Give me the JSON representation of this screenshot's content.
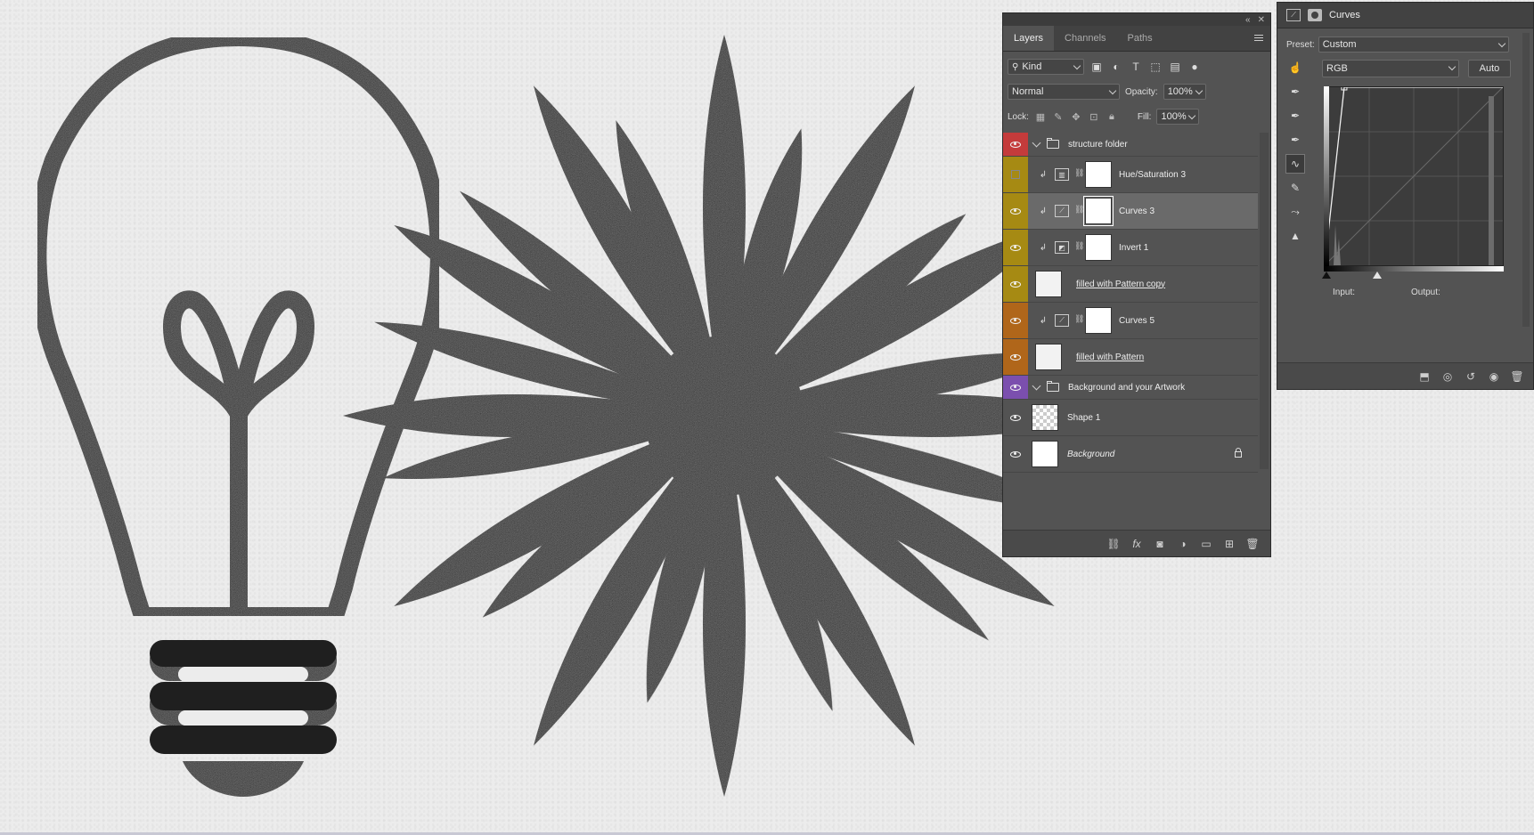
{
  "layers_panel": {
    "tabs": [
      "Layers",
      "Channels",
      "Paths"
    ],
    "filter_kind": "Kind",
    "blend_mode": "Normal",
    "opacity_label": "Opacity:",
    "opacity_value": "100%",
    "lock_label": "Lock:",
    "fill_label": "Fill:",
    "fill_value": "100%",
    "layers": [
      {
        "name": "structure folder",
        "type": "group",
        "color": "#c43b3b",
        "visible": true
      },
      {
        "name": "Hue/Saturation 3",
        "type": "adjustment",
        "icon": "hue-saturation-icon",
        "color": "#a68a13",
        "visible": false,
        "clipped": true
      },
      {
        "name": "Curves 3",
        "type": "adjustment",
        "icon": "curves-icon",
        "color": "#a68a13",
        "visible": true,
        "clipped": true,
        "selected": true
      },
      {
        "name": "Invert 1",
        "type": "adjustment",
        "icon": "invert-icon",
        "color": "#a68a13",
        "visible": true,
        "clipped": true
      },
      {
        "name": "filled with Pattern copy",
        "type": "pattern",
        "color": "#a68a13",
        "visible": true
      },
      {
        "name": "Curves 5",
        "type": "adjustment",
        "icon": "curves-icon",
        "color": "#b0661a",
        "visible": true,
        "clipped": true
      },
      {
        "name": "filled with Pattern",
        "type": "pattern",
        "color": "#b0661a",
        "visible": true
      },
      {
        "name": "Background and your Artwork",
        "type": "group",
        "color": "#7b4fae",
        "visible": true
      },
      {
        "name": "Shape 1",
        "type": "shape",
        "color": "#535353",
        "visible": true
      },
      {
        "name": "Background",
        "type": "background",
        "color": "#535353",
        "visible": true,
        "locked": true
      }
    ]
  },
  "properties_panel": {
    "title": "Curves",
    "preset_label": "Preset:",
    "preset_value": "Custom",
    "channel": "RGB",
    "auto_label": "Auto",
    "input_label": "Input:",
    "output_label": "Output:",
    "curve_points": [
      [
        0,
        0
      ],
      [
        28,
        255
      ]
    ]
  },
  "colors": {
    "canvas": "#ececec",
    "artwork": "#1f1f1f",
    "panel_bg": "#535353",
    "selected_row": "#6a6a6a"
  }
}
